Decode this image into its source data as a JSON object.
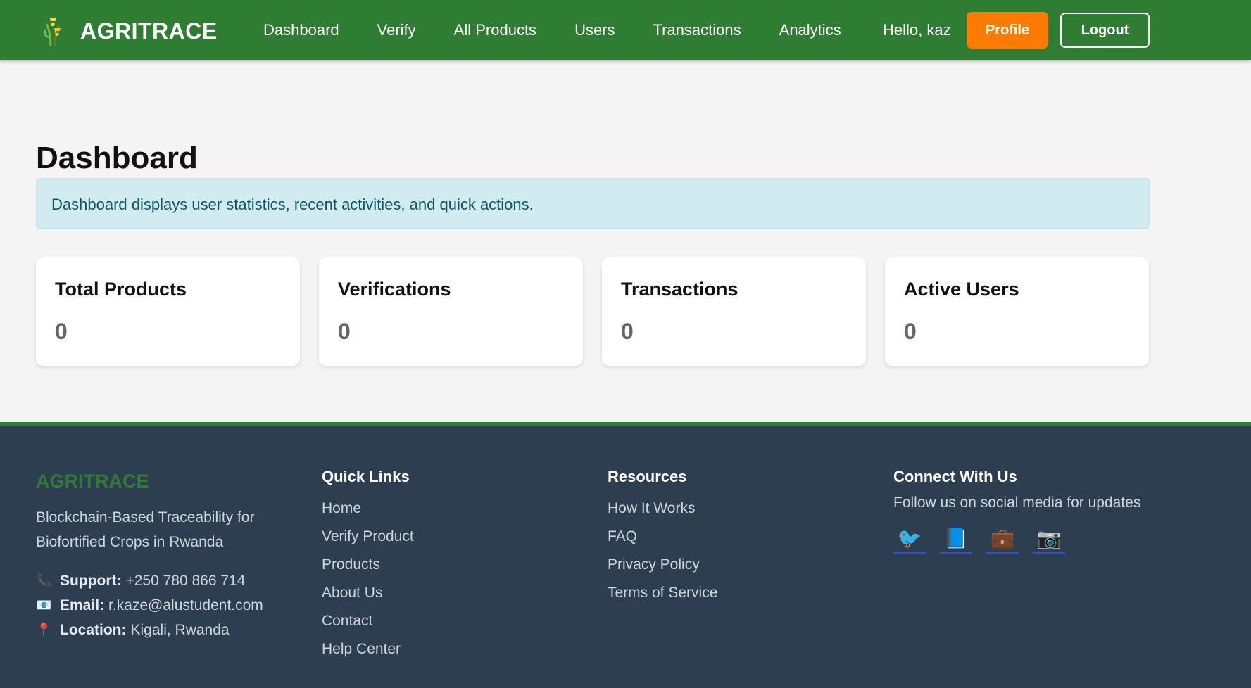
{
  "header": {
    "brand": "AGRITRACE",
    "nav": [
      "Dashboard",
      "Verify",
      "All Products",
      "Users",
      "Transactions",
      "Analytics"
    ],
    "greeting": "Hello, kaz",
    "profile_label": "Profile",
    "logout_label": "Logout"
  },
  "main": {
    "title": "Dashboard",
    "info": "Dashboard displays user statistics, recent activities, and quick actions.",
    "cards": [
      {
        "title": "Total Products",
        "value": "0"
      },
      {
        "title": "Verifications",
        "value": "0"
      },
      {
        "title": "Transactions",
        "value": "0"
      },
      {
        "title": "Active Users",
        "value": "0"
      }
    ]
  },
  "footer": {
    "brand": "AGRITRACE",
    "tagline": "Blockchain-Based Traceability for Biofortified Crops in Rwanda",
    "contact": [
      {
        "icon": "phone-icon",
        "glyph": "📞",
        "label": "Support:",
        "value": "+250 780 866 714"
      },
      {
        "icon": "email-icon",
        "glyph": "📧",
        "label": "Email:",
        "value": "r.kaze@alustudent.com"
      },
      {
        "icon": "location-pin-icon",
        "glyph": "📍",
        "label": "Location:",
        "value": "Kigali, Rwanda"
      }
    ],
    "quick_links": {
      "heading": "Quick Links",
      "items": [
        "Home",
        "Verify Product",
        "Products",
        "About Us",
        "Contact",
        "Help Center"
      ]
    },
    "resources": {
      "heading": "Resources",
      "items": [
        "How It Works",
        "FAQ",
        "Privacy Policy",
        "Terms of Service"
      ]
    },
    "connect": {
      "heading": "Connect With Us",
      "text": "Follow us on social media for updates",
      "icons": [
        {
          "name": "bird-icon",
          "glyph": "🐦"
        },
        {
          "name": "book-icon",
          "glyph": "📘"
        },
        {
          "name": "briefcase-icon",
          "glyph": "💼"
        },
        {
          "name": "camera-icon",
          "glyph": "📷"
        }
      ]
    }
  },
  "colors": {
    "primary_green": "#2e7d32",
    "accent_orange": "#ff7a00",
    "footer_bg": "#2c3e50",
    "info_bg": "#d1ecf1",
    "info_text": "#0c5460"
  }
}
